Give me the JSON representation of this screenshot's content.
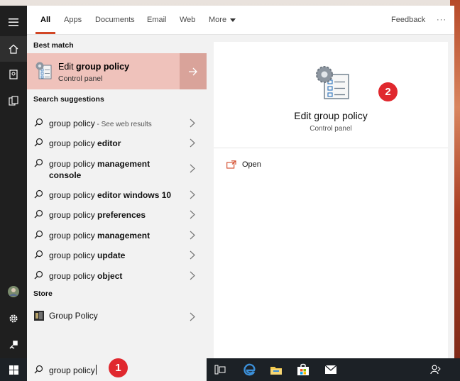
{
  "tabs": [
    {
      "label": "All",
      "active": true
    },
    {
      "label": "Apps"
    },
    {
      "label": "Documents"
    },
    {
      "label": "Email"
    },
    {
      "label": "Web"
    },
    {
      "label": "More"
    }
  ],
  "feedback_label": "Feedback",
  "overflow_label": "···",
  "best_match": {
    "heading": "Best match",
    "title_prefix": "Edit ",
    "title_bold": "group policy",
    "subtitle": "Control panel"
  },
  "suggestions": {
    "heading": "Search suggestions",
    "items": [
      {
        "prefix": "group policy",
        "bold": "",
        "suffix": " - See web results"
      },
      {
        "prefix": "group policy ",
        "bold": "editor",
        "suffix": ""
      },
      {
        "prefix": "group policy ",
        "bold": "management console",
        "suffix": ""
      },
      {
        "prefix": "group policy ",
        "bold": "editor windows 10",
        "suffix": ""
      },
      {
        "prefix": "group policy ",
        "bold": "preferences",
        "suffix": ""
      },
      {
        "prefix": "group policy ",
        "bold": "management",
        "suffix": ""
      },
      {
        "prefix": "group policy ",
        "bold": "update",
        "suffix": ""
      },
      {
        "prefix": "group policy ",
        "bold": "object",
        "suffix": ""
      }
    ]
  },
  "store": {
    "heading": "Store",
    "item": "Group Policy"
  },
  "detail": {
    "title": "Edit group policy",
    "subtitle": "Control panel",
    "open_label": "Open"
  },
  "search": {
    "query": "group policy"
  },
  "badges": [
    "1",
    "2"
  ],
  "colors": {
    "accent": "#d24726",
    "best_match_bg": "#efc2bb",
    "badge": "#e0282e",
    "taskbar": "#1c2126"
  }
}
